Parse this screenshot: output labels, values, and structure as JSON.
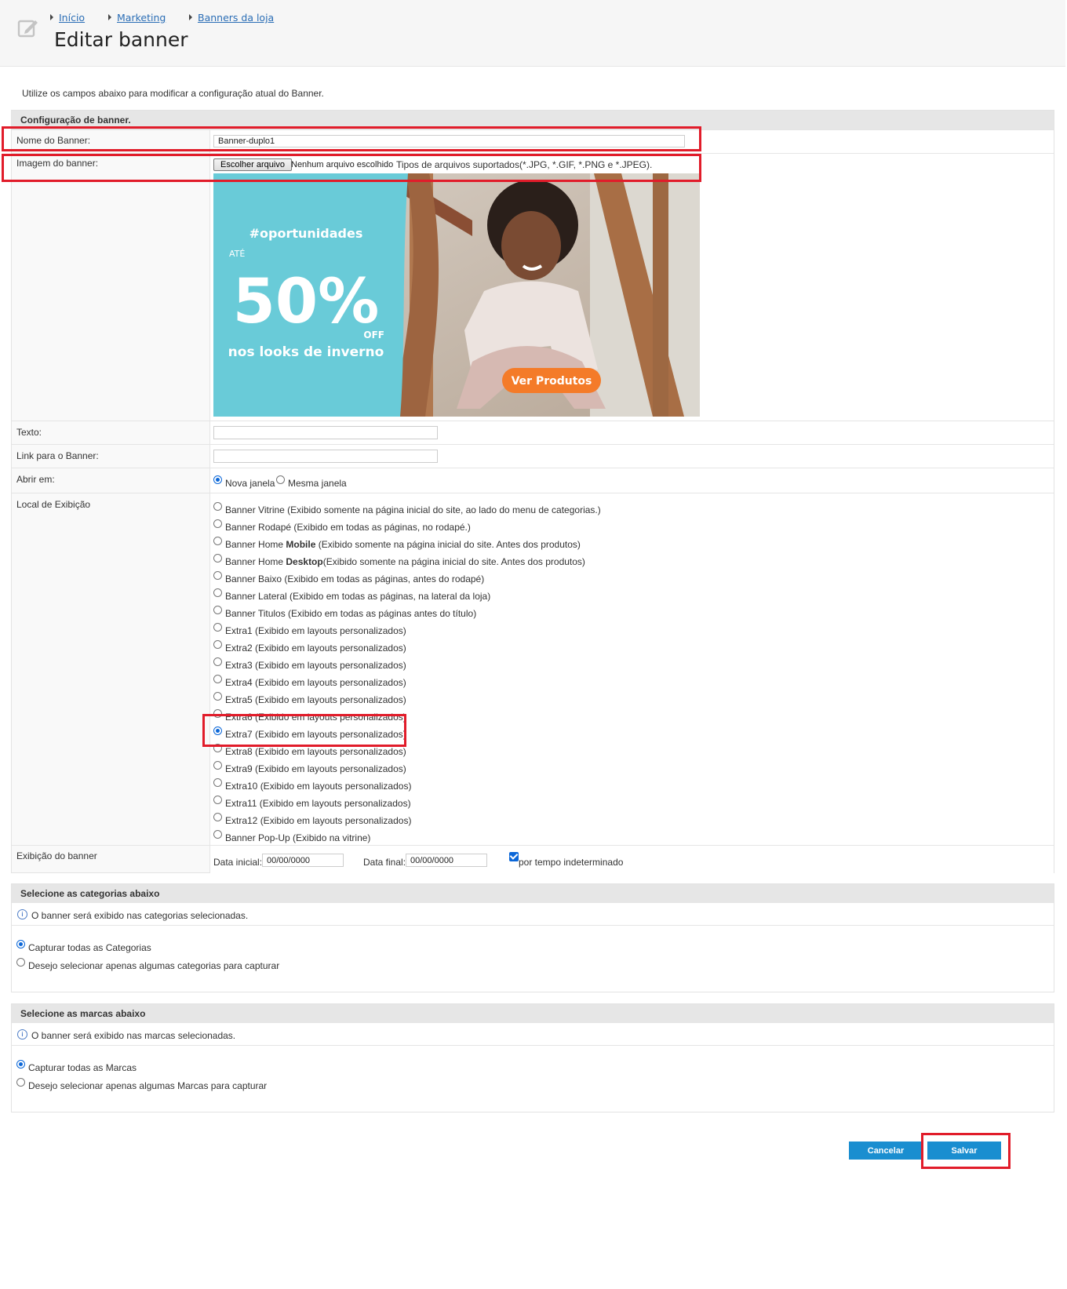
{
  "breadcrumb": [
    {
      "label": "Início"
    },
    {
      "label": "Marketing"
    },
    {
      "label": "Banners da loja"
    }
  ],
  "page_title": "Editar banner",
  "intro_text": "Utilize os campos abaixo para modificar a configuração atual do Banner.",
  "config": {
    "header": "Configuração de banner.",
    "name_label": "Nome do Banner:",
    "name_value": "Banner-duplo1",
    "image_label": "Imagem do banner:",
    "file_button": "Escolher arquivo",
    "file_none": "Nenhum arquivo escolhido",
    "file_types": "Tipos de arquivos suportados(*.JPG, *.GIF, *.PNG e *.JPEG).",
    "banner_preview": {
      "hashtag": "#oportunidades",
      "ate": "ATÉ",
      "percent": "50%",
      "off": "OFF",
      "subtitle": "nos looks de inverno",
      "cta": "Ver Produtos",
      "colors": {
        "panel": "#69cbd8",
        "cta": "#f47b29"
      }
    },
    "text_label": "Texto:",
    "text_value": "",
    "link_label": "Link para o Banner:",
    "link_value": "",
    "open_label": "Abrir em:",
    "open_options": [
      {
        "label": "Nova janela",
        "selected": true
      },
      {
        "label": "Mesma janela",
        "selected": false
      }
    ],
    "local_label": "Local de Exibição",
    "local_options": [
      {
        "pre": "Banner Vitrine (Exibido somente na página inicial do site, ao lado do menu de categorias.)",
        "bold": "",
        "post": "",
        "selected": false
      },
      {
        "pre": "Banner Rodapé (Exibido em todas as páginas, no rodapé.)",
        "bold": "",
        "post": "",
        "selected": false
      },
      {
        "pre": "Banner Home ",
        "bold": "Mobile",
        "post": " (Exibido somente na página inicial do site. Antes dos produtos)",
        "selected": false
      },
      {
        "pre": "Banner Home ",
        "bold": "Desktop",
        "post": "(Exibido somente na página inicial do site. Antes dos produtos)",
        "selected": false
      },
      {
        "pre": "Banner Baixo (Exibido em todas as páginas, antes do rodapé)",
        "bold": "",
        "post": "",
        "selected": false
      },
      {
        "pre": "Banner Lateral (Exibido em todas as páginas, na lateral da loja)",
        "bold": "",
        "post": "",
        "selected": false
      },
      {
        "pre": "Banner Titulos (Exibido em todas as páginas antes do título)",
        "bold": "",
        "post": "",
        "selected": false
      },
      {
        "pre": "Extra1 (Exibido em layouts personalizados)",
        "bold": "",
        "post": "",
        "selected": false
      },
      {
        "pre": "Extra2 (Exibido em layouts personalizados)",
        "bold": "",
        "post": "",
        "selected": false
      },
      {
        "pre": "Extra3 (Exibido em layouts personalizados)",
        "bold": "",
        "post": "",
        "selected": false
      },
      {
        "pre": "Extra4 (Exibido em layouts personalizados)",
        "bold": "",
        "post": "",
        "selected": false
      },
      {
        "pre": "Extra5 (Exibido em layouts personalizados)",
        "bold": "",
        "post": "",
        "selected": false
      },
      {
        "pre": "Extra6 (Exibido em layouts personalizados)",
        "bold": "",
        "post": "",
        "selected": false
      },
      {
        "pre": "Extra7 (Exibido em layouts personalizados)",
        "bold": "",
        "post": "",
        "selected": true
      },
      {
        "pre": "Extra8 (Exibido em layouts personalizados)",
        "bold": "",
        "post": "",
        "selected": false
      },
      {
        "pre": "Extra9 (Exibido em layouts personalizados)",
        "bold": "",
        "post": "",
        "selected": false
      },
      {
        "pre": "Extra10 (Exibido em layouts personalizados)",
        "bold": "",
        "post": "",
        "selected": false
      },
      {
        "pre": "Extra11 (Exibido em layouts personalizados)",
        "bold": "",
        "post": "",
        "selected": false
      },
      {
        "pre": "Extra12 (Exibido em layouts personalizados)",
        "bold": "",
        "post": "",
        "selected": false
      },
      {
        "pre": "Banner Pop-Up (Exibido na vitrine)",
        "bold": "",
        "post": "",
        "selected": false
      }
    ],
    "display_label": "Exibição do banner",
    "start_label": "Data inicial:",
    "start_value": "00/00/0000",
    "end_label": "Data final:",
    "end_value": "00/00/0000",
    "indefinite_label": "por tempo indeterminado",
    "indefinite_checked": true
  },
  "categories": {
    "header": "Selecione as categorias abaixo",
    "info": "O banner será exibido nas categorias selecionadas.",
    "options": [
      {
        "label": "Capturar todas as Categorias",
        "selected": true
      },
      {
        "label": "Desejo selecionar apenas algumas categorias para capturar",
        "selected": false
      }
    ]
  },
  "brands": {
    "header": "Selecione as marcas abaixo",
    "info": "O banner será exibido nas marcas selecionadas.",
    "options": [
      {
        "label": "Capturar todas as Marcas",
        "selected": true
      },
      {
        "label": "Desejo selecionar apenas algumas Marcas para capturar",
        "selected": false
      }
    ]
  },
  "actions": {
    "cancel": "Cancelar",
    "save": "Salvar"
  },
  "annotation_color": "#e11c2a",
  "icons": [
    "edit-icon",
    "breadcrumb-arrow-icon",
    "info-icon"
  ]
}
